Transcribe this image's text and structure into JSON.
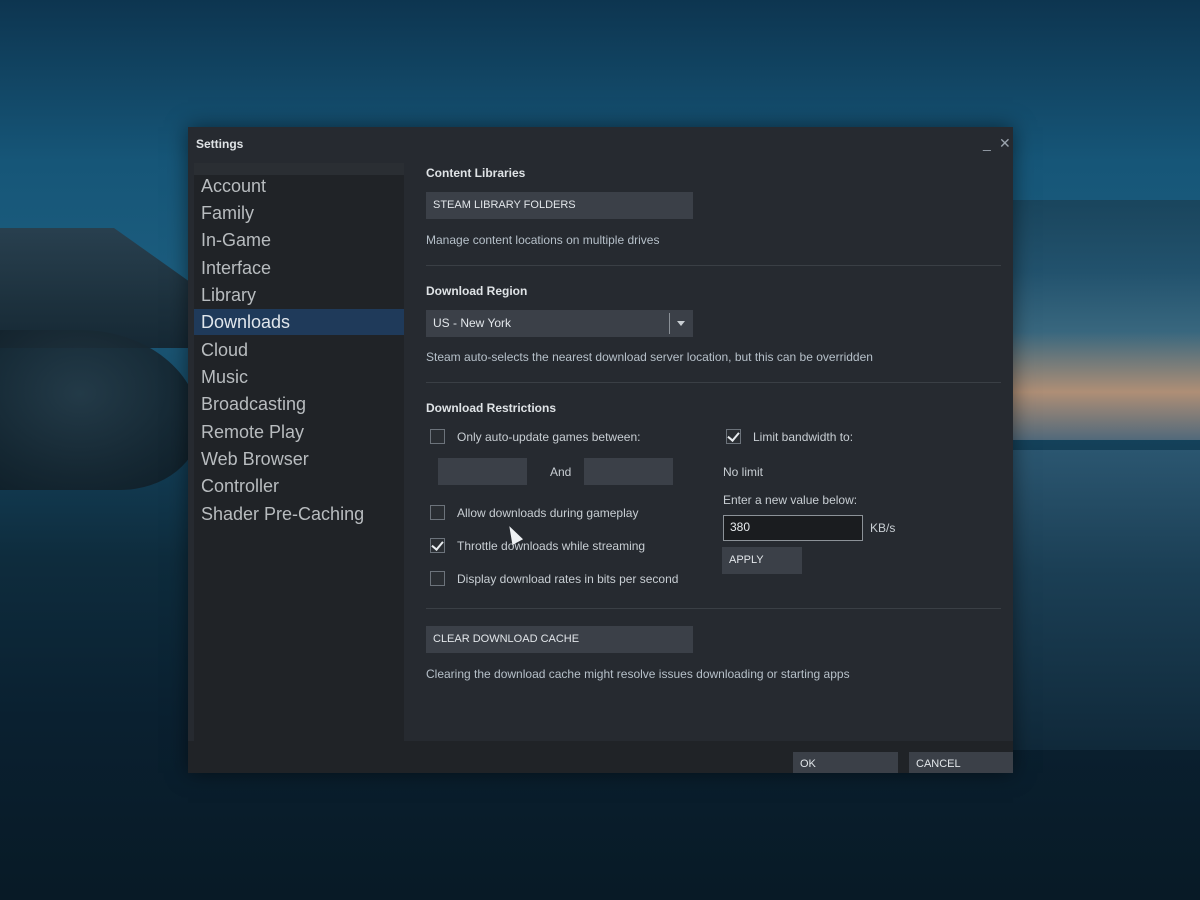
{
  "window": {
    "title": "Settings",
    "minimize": "_",
    "close": "✕"
  },
  "sidebar": {
    "items": [
      {
        "label": "Account"
      },
      {
        "label": "Family"
      },
      {
        "label": "In-Game"
      },
      {
        "label": "Interface"
      },
      {
        "label": "Library"
      },
      {
        "label": "Downloads",
        "active": true
      },
      {
        "label": "Cloud"
      },
      {
        "label": "Music"
      },
      {
        "label": "Broadcasting"
      },
      {
        "label": "Remote Play"
      },
      {
        "label": "Web Browser"
      },
      {
        "label": "Controller"
      },
      {
        "label": "Shader Pre-Caching"
      }
    ]
  },
  "content_libraries": {
    "heading": "Content Libraries",
    "button": "STEAM LIBRARY FOLDERS",
    "description": "Manage content locations on multiple drives"
  },
  "download_region": {
    "heading": "Download Region",
    "selected": "US - New York",
    "description": "Steam auto-selects the nearest download server location, but this can be overridden"
  },
  "download_restrictions": {
    "heading": "Download Restrictions",
    "auto_update": {
      "label": "Only auto-update games between:",
      "checked": false
    },
    "and_label": "And",
    "allow_gameplay": {
      "label": "Allow downloads during gameplay",
      "checked": false
    },
    "throttle_streaming": {
      "label": "Throttle downloads while streaming",
      "checked": true
    },
    "bits_per_second": {
      "label": "Display download rates in bits per second",
      "checked": false
    },
    "limit_bandwidth": {
      "label": "Limit bandwidth to:",
      "checked": true
    },
    "current_limit": "No limit",
    "enter_value": "Enter a new value below:",
    "bandwidth_value": "380",
    "unit": "KB/s",
    "apply": "APPLY"
  },
  "cache": {
    "button": "CLEAR DOWNLOAD CACHE",
    "description": "Clearing the download cache might resolve issues downloading or starting apps"
  },
  "footer": {
    "ok": "OK",
    "cancel": "CANCEL"
  }
}
